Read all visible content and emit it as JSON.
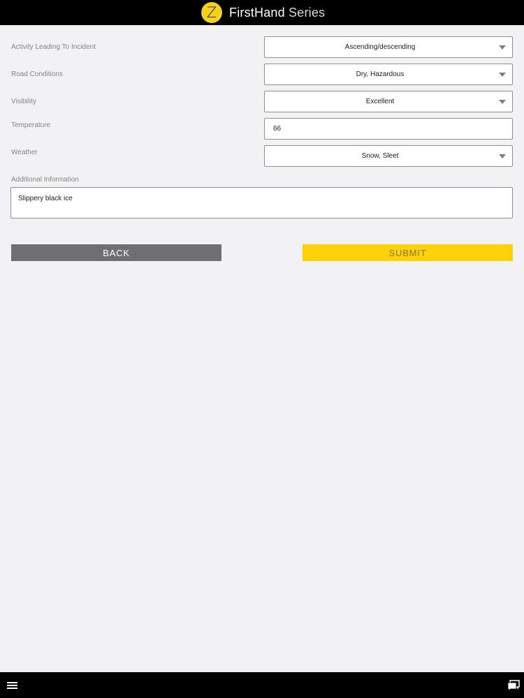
{
  "header": {
    "logo_letter": "Z",
    "brand_bold": "FirstHand",
    "brand_light": "Series",
    "accent_color": "#f5d21e"
  },
  "form": {
    "activity": {
      "label": "Activity Leading To Incident",
      "value": "Ascending/descending"
    },
    "road_conditions": {
      "label": "Road Conditions",
      "value": "Dry, Hazardous"
    },
    "visibility": {
      "label": "Visibility",
      "value": "Excellent"
    },
    "temperature": {
      "label": "Temperature",
      "value": "66"
    },
    "weather": {
      "label": "Weather",
      "value": "Snow, Sleet"
    },
    "additional_info": {
      "label": "Additional Information",
      "value": "Slippery black ice"
    }
  },
  "actions": {
    "back_label": "BACK",
    "submit_label": "SUBMIT",
    "back_color": "#6f6f71",
    "submit_color": "#fdd20b"
  },
  "footer": {
    "menu_icon": "hamburger-menu-icon",
    "chat_icon": "chat-bubble-icon"
  }
}
